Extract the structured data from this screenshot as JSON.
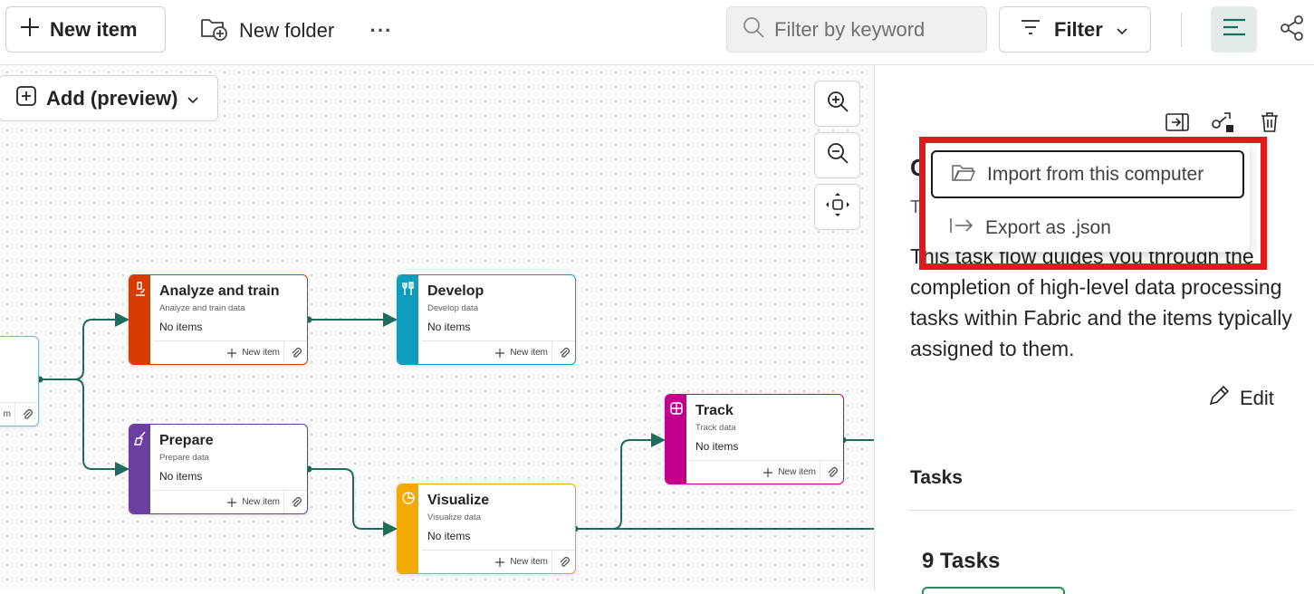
{
  "toolbar": {
    "new_item_label": "New item",
    "new_folder_label": "New folder",
    "more_label": "···",
    "search_placeholder": "Filter by keyword",
    "filter_label": "Filter"
  },
  "canvas": {
    "add_label": "Add (preview)",
    "cards": [
      {
        "title": "Analyze and train",
        "subtitle": "Analyze and train data",
        "count": "No items",
        "new_item": "New item",
        "color": "#d83b01"
      },
      {
        "title": "Develop",
        "subtitle": "Develop data",
        "count": "No items",
        "new_item": "New item",
        "color": "#0f9cbd"
      },
      {
        "title": "Prepare",
        "subtitle": "Prepare data",
        "count": "No items",
        "new_item": "New item",
        "color": "#6b3fa0"
      },
      {
        "title": "Visualize",
        "subtitle": "Visualize data",
        "count": "No items",
        "new_item": "New item",
        "color": "#f2a900"
      },
      {
        "title": "Track",
        "subtitle": "Track data",
        "count": "No items",
        "new_item": "New item",
        "color": "#c3008c"
      }
    ],
    "partial_card_footer": "m"
  },
  "panel": {
    "heading_partial": "G",
    "sub_partial": "T",
    "description": "This task flow guides you through the completion of high-level data processing tasks within Fabric and the items typically assigned to them.",
    "edit_label": "Edit",
    "tasks_label": "Tasks",
    "tasks_count": "9 Tasks"
  },
  "menu": {
    "import_label": "Import from this computer",
    "export_label": "Export as .json"
  },
  "colors": {
    "connector": "#1f6b5c",
    "highlight": "#e01a1a",
    "accent_green": "#2e8b57"
  }
}
